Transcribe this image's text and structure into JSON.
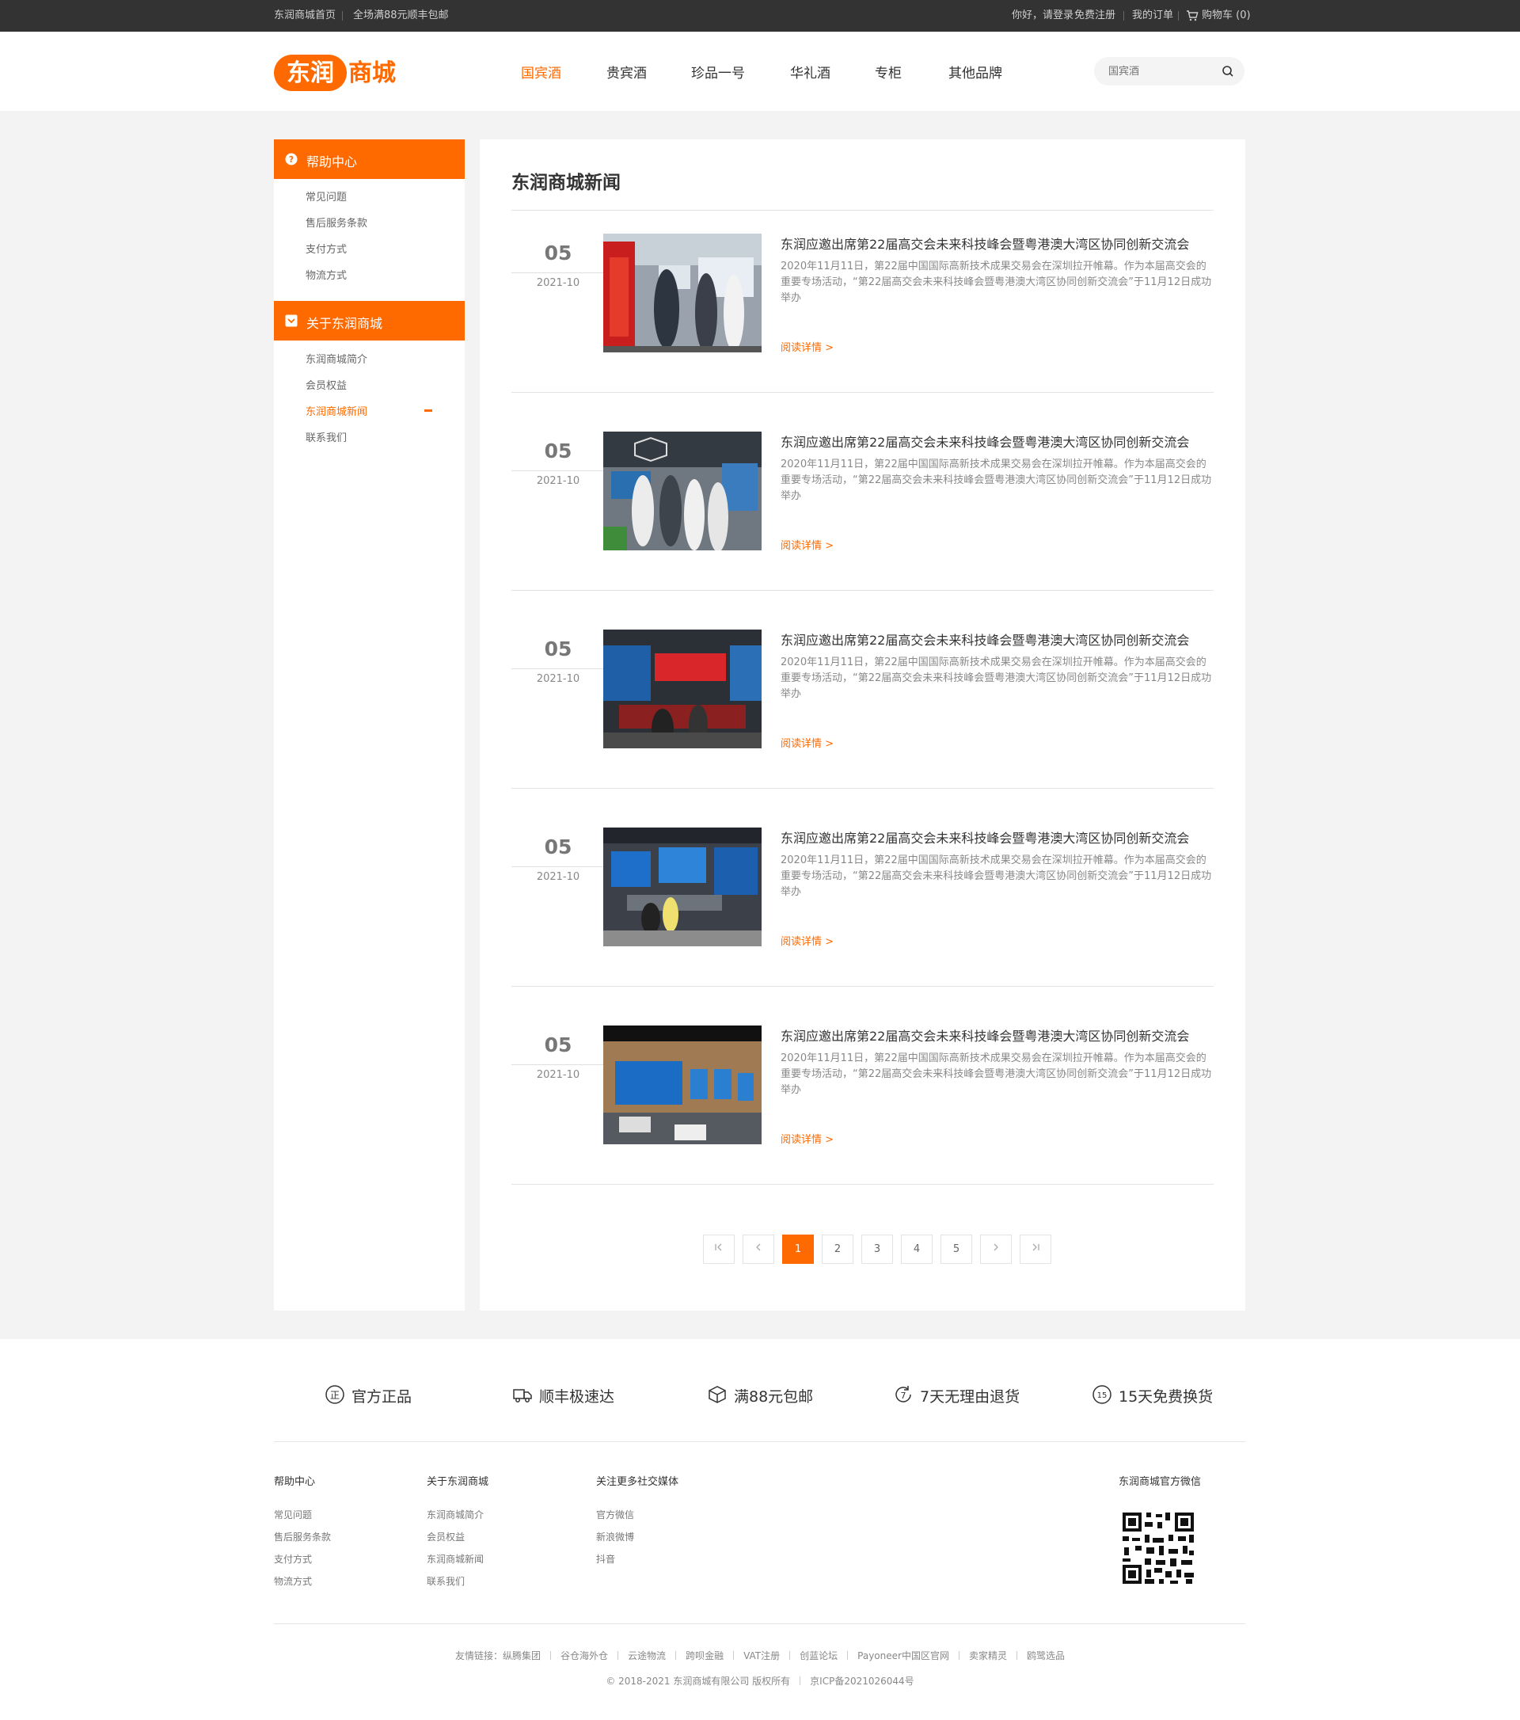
{
  "topbar": {
    "home": "东润商城首页",
    "promo": "全场满88元顺丰包邮",
    "login": "你好，请登录",
    "register": "免费注册",
    "orders": "我的订单",
    "cart": "购物车 (0)"
  },
  "header": {
    "logo_text": "东润商城",
    "nav": [
      "国宾酒",
      "贵宾酒",
      "珍品一号",
      "华礼酒",
      "专柜",
      "其他品牌"
    ],
    "search_placeholder": "国宾酒"
  },
  "sidebar": {
    "help": {
      "title": "帮助中心",
      "items": [
        "常见问题",
        "售后服务条款",
        "支付方式",
        "物流方式"
      ]
    },
    "about": {
      "title": "关于东润商城",
      "items": [
        "东润商城简介",
        "会员权益",
        "东润商城新闻",
        "联系我们"
      ],
      "active_index": 2
    }
  },
  "main": {
    "title": "东润商城新闻",
    "news": [
      {
        "day": "05",
        "ym": "2021-10",
        "title": "东润应邀出席第22届高交会未来科技峰会暨粤港澳大湾区协同创新交流会",
        "desc": "2020年11月11日，第22届中国国际高新技术成果交易会在深圳拉开帷幕。作为本届高交会的重要专场活动，“第22届高交会未来科技峰会暨粤港澳大湾区协同创新交流会”于11月12日成功举办",
        "more": "阅读详情 >"
      },
      {
        "day": "05",
        "ym": "2021-10",
        "title": "东润应邀出席第22届高交会未来科技峰会暨粤港澳大湾区协同创新交流会",
        "desc": "2020年11月11日，第22届中国国际高新技术成果交易会在深圳拉开帷幕。作为本届高交会的重要专场活动，“第22届高交会未来科技峰会暨粤港澳大湾区协同创新交流会”于11月12日成功举办",
        "more": "阅读详情 >"
      },
      {
        "day": "05",
        "ym": "2021-10",
        "title": "东润应邀出席第22届高交会未来科技峰会暨粤港澳大湾区协同创新交流会",
        "desc": "2020年11月11日，第22届中国国际高新技术成果交易会在深圳拉开帷幕。作为本届高交会的重要专场活动，“第22届高交会未来科技峰会暨粤港澳大湾区协同创新交流会”于11月12日成功举办",
        "more": "阅读详情 >"
      },
      {
        "day": "05",
        "ym": "2021-10",
        "title": "东润应邀出席第22届高交会未来科技峰会暨粤港澳大湾区协同创新交流会",
        "desc": "2020年11月11日，第22届中国国际高新技术成果交易会在深圳拉开帷幕。作为本届高交会的重要专场活动，“第22届高交会未来科技峰会暨粤港澳大湾区协同创新交流会”于11月12日成功举办",
        "more": "阅读详情 >"
      },
      {
        "day": "05",
        "ym": "2021-10",
        "title": "东润应邀出席第22届高交会未来科技峰会暨粤港澳大湾区协同创新交流会",
        "desc": "2020年11月11日，第22届中国国际高新技术成果交易会在深圳拉开帷幕。作为本届高交会的重要专场活动，“第22届高交会未来科技峰会暨粤港澳大湾区协同创新交流会”于11月12日成功举办",
        "more": "阅读详情 >"
      }
    ]
  },
  "pager": {
    "first_icon": "first-page-icon",
    "prev_icon": "chevron-left-icon",
    "pages": [
      "1",
      "2",
      "3",
      "4",
      "5"
    ],
    "active_page": "1",
    "next_icon": "chevron-right-icon",
    "last_icon": "last-page-icon"
  },
  "footer": {
    "features": [
      {
        "icon": "genuine-icon",
        "label": "官方正品"
      },
      {
        "icon": "truck-icon",
        "label": "顺丰极速达"
      },
      {
        "icon": "box-icon",
        "label": "满88元包邮"
      },
      {
        "icon": "return-7-icon",
        "label": "7天无理由退货"
      },
      {
        "icon": "exchange-15-icon",
        "label": "15天免费换货"
      }
    ],
    "cols": [
      {
        "title": "帮助中心",
        "links": [
          "常见问题",
          "售后服务条款",
          "支付方式",
          "物流方式"
        ]
      },
      {
        "title": "关于东润商城",
        "links": [
          "东润商城简介",
          "会员权益",
          "东润商城新闻",
          "联系我们"
        ]
      },
      {
        "title": "关注更多社交媒体",
        "links": [
          "官方微信",
          "新浪微博",
          "抖音"
        ]
      }
    ],
    "wechat_title": "东润商城官方微信",
    "friend_label": "友情链接：",
    "friend_links": [
      "纵腾集团",
      "谷仓海外仓",
      "云途物流",
      "跨呗金融",
      "VAT注册",
      "创蓝论坛",
      "Payoneer中国区官网",
      "卖家精灵",
      "鸥鹭选品"
    ],
    "copyright": "© 2018-2021 东润商城有限公司 版权所有",
    "icp": "京ICP备2021026044号"
  },
  "colors": {
    "accent": "#ff6a00",
    "topbar": "#333333"
  }
}
